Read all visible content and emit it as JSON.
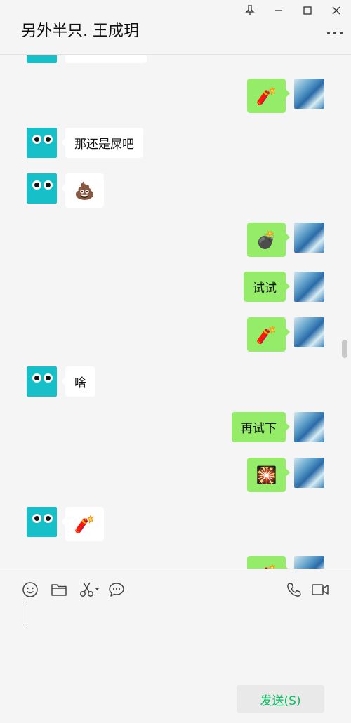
{
  "header": {
    "title": "另外半只. 王成玥"
  },
  "window_controls": {
    "icons": [
      "pin-icon",
      "minimize-icon",
      "maximize-icon",
      "close-icon"
    ]
  },
  "messages": [
    {
      "side": "left",
      "type": "text",
      "text": ""
    },
    {
      "side": "right",
      "type": "emoji",
      "text": "🧨"
    },
    {
      "side": "left",
      "type": "text",
      "text": "那还是屎吧"
    },
    {
      "side": "left",
      "type": "emoji",
      "text": "💩"
    },
    {
      "side": "right",
      "type": "emoji",
      "text": "💣"
    },
    {
      "side": "right",
      "type": "text",
      "text": "试试"
    },
    {
      "side": "right",
      "type": "emoji",
      "text": "🧨"
    },
    {
      "side": "left",
      "type": "text",
      "text": "啥"
    },
    {
      "side": "right",
      "type": "text",
      "text": "再试下"
    },
    {
      "side": "right",
      "type": "emoji",
      "text": "🎇"
    },
    {
      "side": "left",
      "type": "emoji",
      "text": "🧨"
    },
    {
      "side": "right",
      "type": "emoji",
      "text": "🧨"
    }
  ],
  "toolbar": {
    "icons": [
      "emoji-icon",
      "folder-icon",
      "scissors-icon",
      "chat-bubble-icon",
      "phone-icon",
      "video-icon"
    ]
  },
  "send": {
    "label": "发送(S)"
  },
  "colors": {
    "accent_green": "#07c160",
    "bubble_self": "#95ec69",
    "bubble_other": "#ffffff",
    "avatar_teal": "#17bfc8"
  }
}
